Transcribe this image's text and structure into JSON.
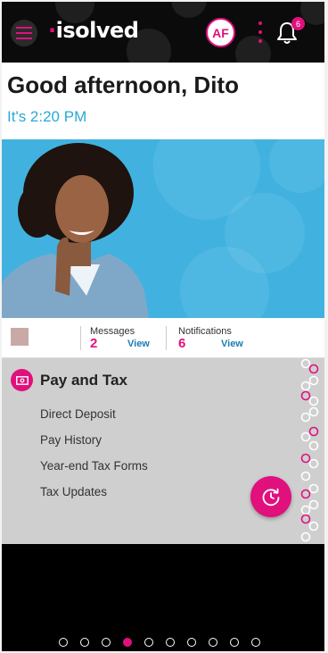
{
  "header": {
    "logo_prefix": "·",
    "logo_text": "isolved",
    "avatar_initials": "AF",
    "notification_badge": "6"
  },
  "greeting": {
    "title": "Good afternoon, Dito",
    "time": "It's 2:20 PM"
  },
  "counts": {
    "messages_label": "Messages",
    "messages_count": "2",
    "messages_view": "View",
    "notifications_label": "Notifications",
    "notifications_count": "6",
    "notifications_view": "View"
  },
  "card": {
    "title": "Pay and Tax",
    "items": [
      "Direct Deposit",
      "Pay History",
      "Year-end Tax Forms",
      "Tax Updates"
    ]
  },
  "pagination": {
    "count": 10,
    "active_index": 3
  },
  "colors": {
    "brand": "#e0107d",
    "accent_blue": "#2aa9d6",
    "link_blue": "#1d7bb5",
    "hero_bg": "#41b2e0"
  },
  "icons": {
    "menu": "hamburger-icon",
    "more": "more-vert-icon",
    "bell": "bell-icon",
    "card": "money-icon",
    "fab": "clock-icon"
  }
}
